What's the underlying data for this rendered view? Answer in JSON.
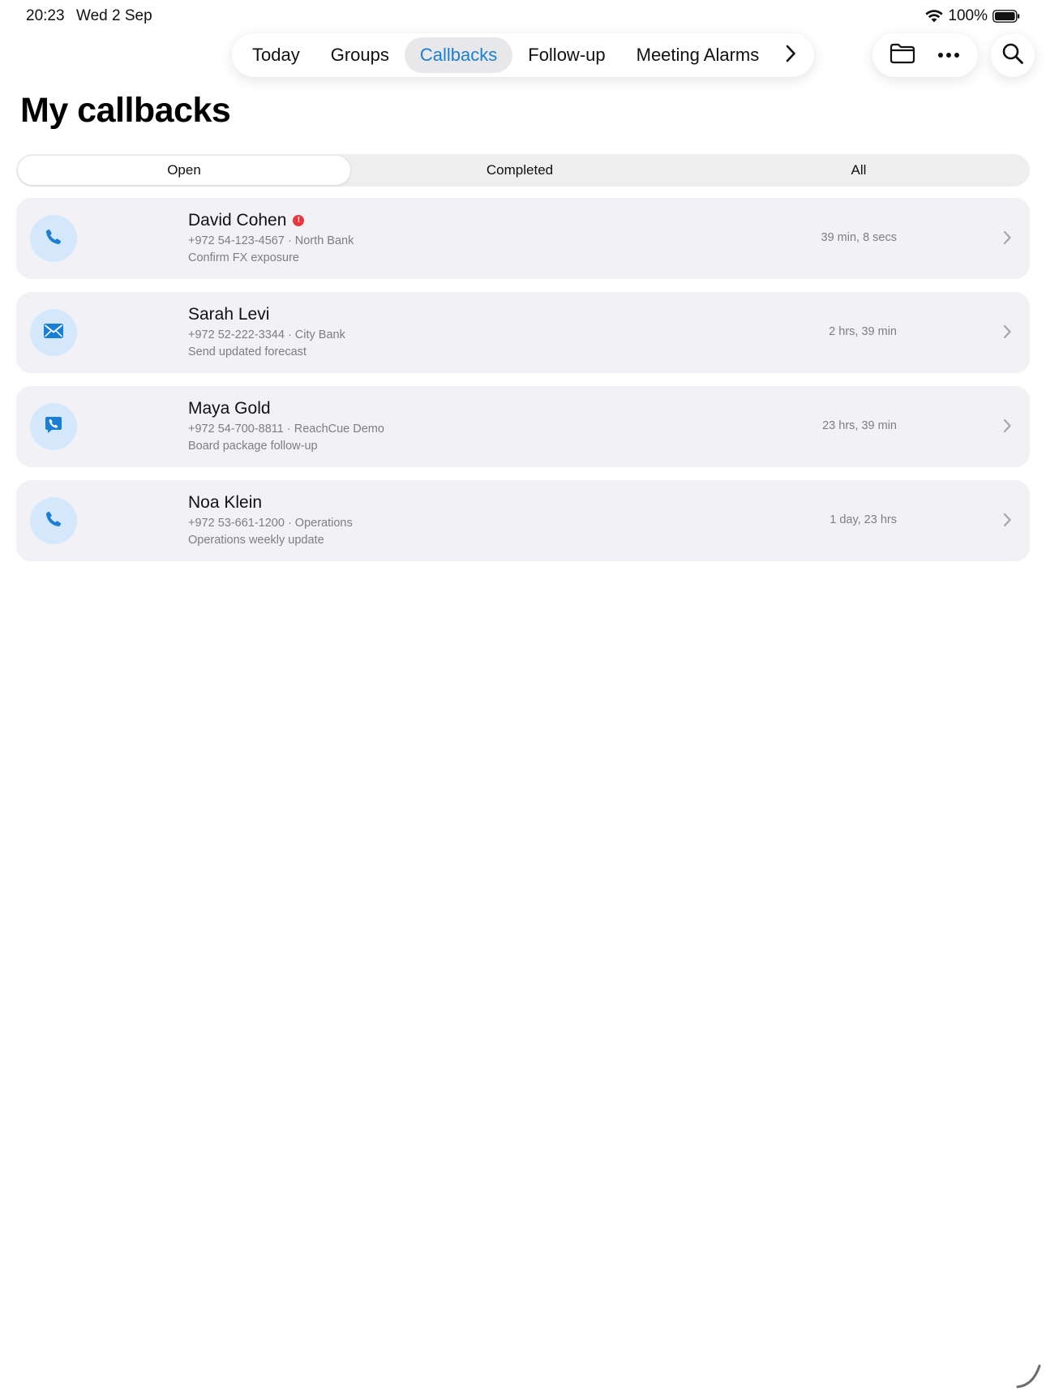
{
  "status_bar": {
    "time": "20:23",
    "date": "Wed 2 Sep",
    "battery": "100%",
    "icons": [
      "wifi-icon",
      "battery-icon"
    ]
  },
  "nav": {
    "tabs": [
      {
        "label": "Today"
      },
      {
        "label": "Groups"
      },
      {
        "label": "Callbacks",
        "active": true
      },
      {
        "label": "Follow-up"
      },
      {
        "label": "Meeting Alarms"
      }
    ],
    "more_icon": "chevron-right-icon",
    "actions": [
      "folder-icon",
      "more-icon"
    ],
    "search_icon": "search-icon"
  },
  "page": {
    "title": "My callbacks"
  },
  "filter": {
    "segments": [
      {
        "label": "Open",
        "active": true
      },
      {
        "label": "Completed"
      },
      {
        "label": "All"
      }
    ]
  },
  "callbacks": [
    {
      "name": "David Cohen",
      "alert": "!",
      "detail": "+972 54-123-4567 · North Bank",
      "note": "Confirm FX exposure",
      "elapsed": "39 min, 8 secs",
      "icon": "phone-icon"
    },
    {
      "name": "Sarah Levi",
      "detail": "+972 52-222-3344 · City Bank",
      "note": "Send updated forecast",
      "elapsed": "2 hrs, 39 min",
      "icon": "envelope-icon"
    },
    {
      "name": "Maya Gold",
      "detail": "+972 54-700-8811 · ReachCue Demo",
      "note": "Board package follow-up",
      "elapsed": "23 hrs, 39 min",
      "icon": "message-phone-icon"
    },
    {
      "name": "Noa Klein",
      "detail": "+972 53-661-1200 · Operations",
      "note": "Operations weekly update",
      "elapsed": "1 day, 23 hrs",
      "icon": "phone-icon"
    }
  ],
  "colors": {
    "accent": "#1a7fd4",
    "row_bg": "#f2f2f6",
    "icon_bg": "#d4e7fb",
    "alert": "#e8383d"
  }
}
